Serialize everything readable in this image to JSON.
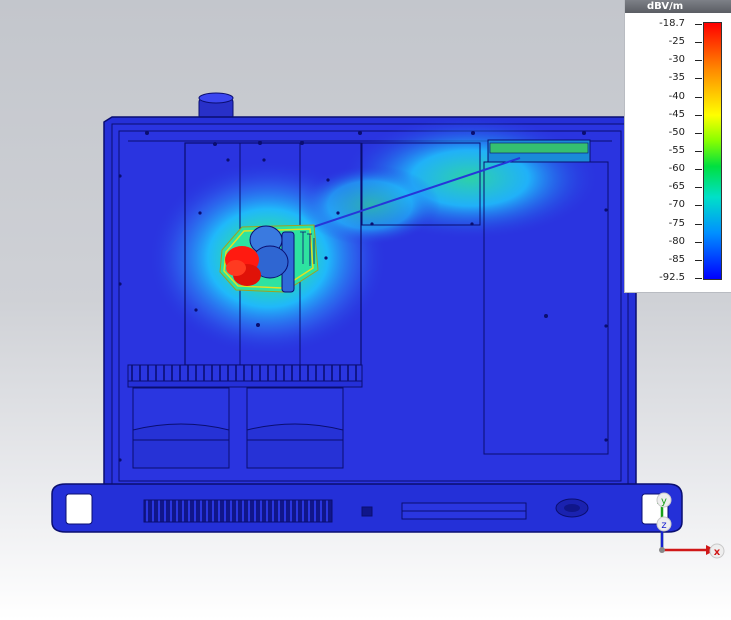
{
  "legend": {
    "unit": "dBV/m",
    "ticks": [
      "-18.7",
      "-25",
      "-30",
      "-35",
      "-40",
      "-45",
      "-50",
      "-55",
      "-60",
      "-65",
      "-70",
      "-75",
      "-80",
      "-85",
      "-92.5"
    ],
    "colors": [
      "#ff0000",
      "#ff8800",
      "#ffff00",
      "#88ff00",
      "#00e040",
      "#00e0c8",
      "#0090ff",
      "#0000ff"
    ]
  },
  "axes": {
    "x_label": "x",
    "y_label": "y",
    "z_label": "z"
  },
  "model": {
    "chassis_color": "#2a34e0",
    "hotspot_color": "#ff1a10",
    "field_colors": [
      "#1ed0ff",
      "#2ee3a0",
      "#b8ff20"
    ]
  }
}
